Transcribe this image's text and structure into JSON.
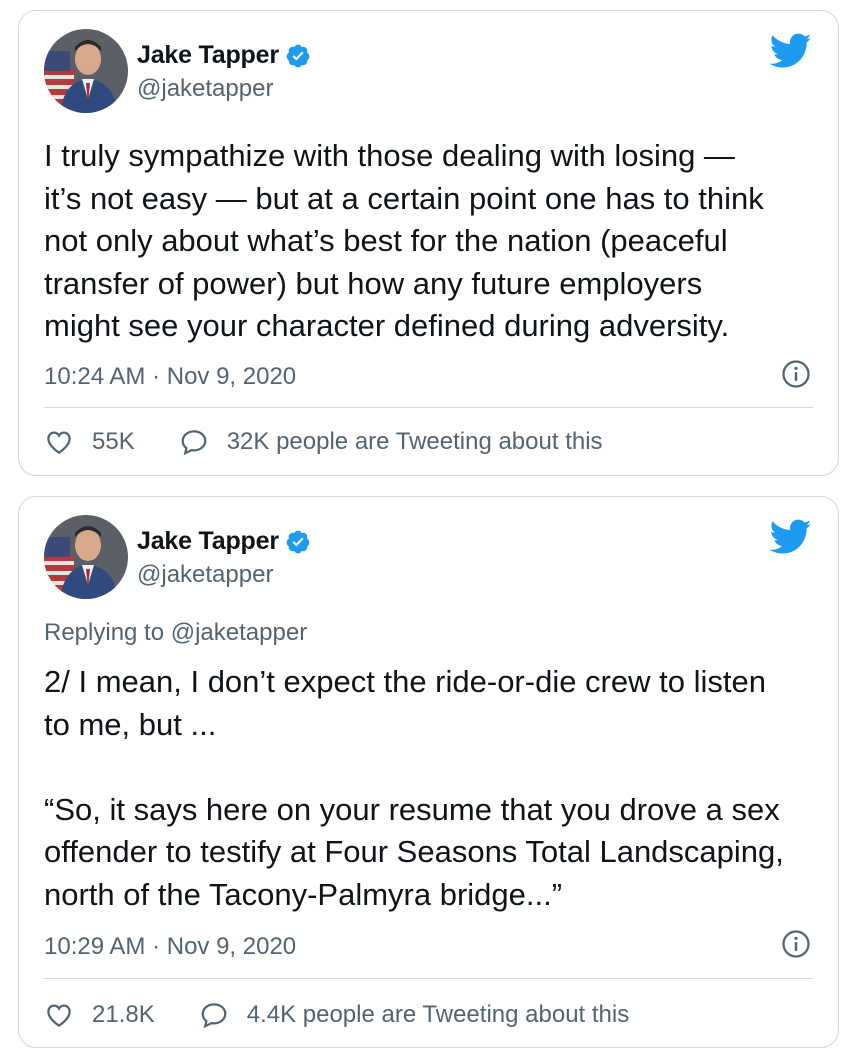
{
  "colors": {
    "accent": "#1d9bf0",
    "text": "#0f1419",
    "secondary": "#536471",
    "border": "#cfd9de"
  },
  "tweets": [
    {
      "author": {
        "name": "Jake Tapper",
        "handle": "@jaketapper",
        "verified": true
      },
      "replying_to": "",
      "text": "I truly sympathize with those dealing with losing —\nit’s not easy — but at a certain point one has to think\nnot only about what’s best for the nation (peaceful\ntransfer of power) but how any future employers\nmight see your character defined during adversity.",
      "timestamp": "10:24 AM · Nov 9, 2020",
      "likes": "55K",
      "tweeting_about": "32K people are Tweeting about this"
    },
    {
      "author": {
        "name": "Jake Tapper",
        "handle": "@jaketapper",
        "verified": true
      },
      "replying_to": "Replying to @jaketapper",
      "text": "2/ I mean, I don’t expect the ride-or-die crew to listen\nto me, but ...\n\n“So, it says here on your resume that you drove a sex\noffender to testify at Four Seasons Total Landscaping,\nnorth of the Tacony-Palmyra bridge...”",
      "timestamp": "10:29 AM · Nov 9, 2020",
      "likes": "21.8K",
      "tweeting_about": "4.4K people are Tweeting about this"
    }
  ],
  "icons": [
    "avatar",
    "verified-badge-icon",
    "twitter-bird-icon",
    "info-icon",
    "heart-icon",
    "speech-bubble-icon"
  ]
}
